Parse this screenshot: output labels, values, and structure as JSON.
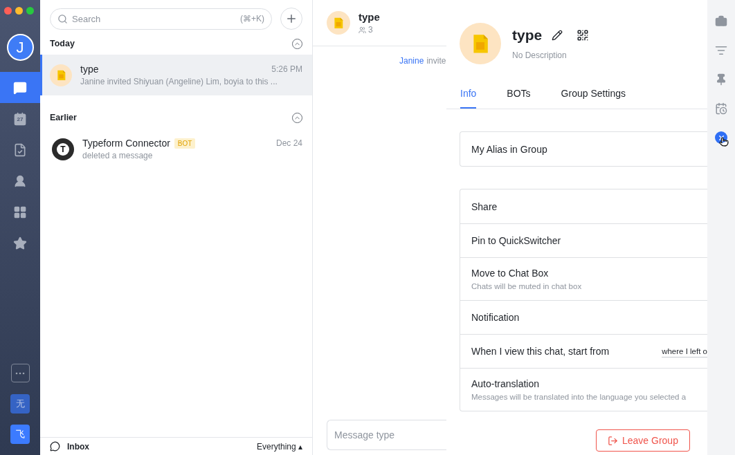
{
  "user_avatar": {
    "letter": "J"
  },
  "nav_items": [
    {
      "selected": true
    },
    {
      "selected": false,
      "label": "27"
    },
    {
      "selected": false
    },
    {
      "selected": false
    },
    {
      "selected": false
    },
    {
      "selected": false
    }
  ],
  "bottom_apps": [
    {
      "label": "无",
      "selected": false
    },
    {
      "label": "飞",
      "selected": true
    }
  ],
  "search": {
    "placeholder": "Search",
    "shortcut": "(⌘+K)"
  },
  "sections": [
    {
      "title": "Today",
      "chats": [
        {
          "kind": "file",
          "name": "type",
          "time": "5:26 PM",
          "preview": "Janine invited Shiyuan (Angeline) Lim, boyia to this ...",
          "selected": true
        }
      ]
    },
    {
      "title": "Earlier",
      "chats": [
        {
          "kind": "letter",
          "letter": "T",
          "name": "Typeform Connector",
          "badge": "BOT",
          "time": "Dec 24",
          "preview": "deleted a message",
          "selected": false
        }
      ]
    }
  ],
  "footer": {
    "label": "Inbox",
    "filter": "Everything",
    "filter_arrow": "▴"
  },
  "chat": {
    "title": "type",
    "members": "3",
    "message_author": "Janine",
    "message_text": "invite",
    "input_placeholder": "Message type"
  },
  "group_panel": {
    "title": "type",
    "description": "No Description",
    "tabs": [
      {
        "label": "Info",
        "selected": true
      },
      {
        "label": "BOTs",
        "selected": false
      },
      {
        "label": "Group Settings",
        "selected": false
      }
    ],
    "alias_row": {
      "title": "My Alias in Group"
    },
    "rows": [
      {
        "title": "Share"
      },
      {
        "title": "Pin to QuickSwitcher"
      },
      {
        "title": "Move to Chat Box",
        "subtitle": "Chats will be muted in chat box"
      },
      {
        "title": "Notification"
      },
      {
        "title": "When I view this chat, start from",
        "value": "where I left o"
      },
      {
        "title": "Auto-translation",
        "subtitle": "Messages will be translated into the language you selected a"
      }
    ],
    "leave_button": "Leave Group"
  }
}
